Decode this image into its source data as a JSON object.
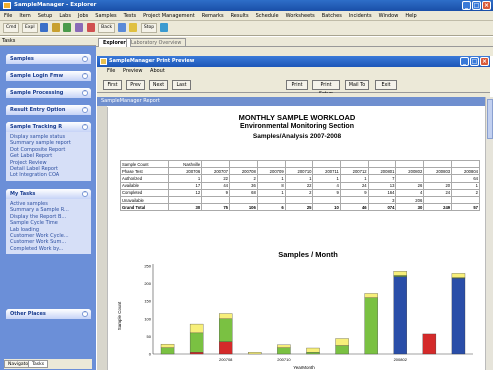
{
  "window": {
    "title": "SampleManager - Explorer"
  },
  "menubar": [
    "File",
    "Item",
    "Setup",
    "Labs",
    "Jobs",
    "Samples",
    "Tests",
    "Project Management",
    "Remarks",
    "Results",
    "Schedule",
    "Worksheets",
    "Batches",
    "Incidents",
    "Window",
    "Help"
  ],
  "toolbar": {
    "items": [
      "Cmd",
      "Expl",
      "Back",
      "Stop"
    ]
  },
  "nav": {
    "header": "Tasks",
    "panels": [
      {
        "title": "Samples",
        "items": []
      },
      {
        "title": "Sample Login Fmw",
        "items": []
      },
      {
        "title": "Sample Processing",
        "items": []
      },
      {
        "title": "Result Entry Option",
        "items": []
      },
      {
        "title": "Sample Tracking R",
        "items": [
          "Display sample status",
          "Summary sample report",
          "Dot Composite Report",
          "Get Label Report",
          "Project Review",
          "Detail Label Report",
          "Lot Integration COA"
        ]
      },
      {
        "title": "My Tasks",
        "items": [
          "Active samples",
          "Summary a Sample R...",
          "Display the Report B...",
          "Sample Cycle Time",
          "Lab loading",
          "Customer Work Cycle...",
          "Customer Work Sum...",
          "Completed Work by..."
        ]
      },
      {
        "title": "Other Places",
        "items": []
      }
    ],
    "tabs": [
      "Navigator",
      "Tasks"
    ]
  },
  "tabs": [
    {
      "label": "Explorer"
    },
    {
      "label": "Laboratory Overview"
    }
  ],
  "preview": {
    "title": "SampleManager Print Preview",
    "menu": [
      "File",
      "Preview",
      "About"
    ],
    "buttons": [
      "First",
      "Prev",
      "Next",
      "Last",
      "Print",
      "Print Setup",
      "Mail To",
      "Exit"
    ],
    "report_strip": "SampleManager Report"
  },
  "report": {
    "title1": "MONTHLY SAMPLE WORKLOAD",
    "title2": "Environmental Monitoring Section",
    "title3": "Samples/Analysis 2007-2008",
    "table": {
      "corner_label": "Sample Count",
      "facility": "Nashville",
      "phase_label": "Phase Test",
      "columns": [
        "200706",
        "200707",
        "200708",
        "200709",
        "200710",
        "200711",
        "200712",
        "200801",
        "200802",
        "200803",
        "200804"
      ],
      "rows": [
        {
          "label": "Authorized",
          "values": [
            "1",
            "22",
            "2",
            "1",
            "1",
            "1",
            "1",
            "7",
            "",
            "",
            "64"
          ]
        },
        {
          "label": "Available",
          "values": [
            "17",
            "44",
            "36",
            "8",
            "22",
            "4",
            "24",
            "13",
            "26",
            "20",
            "1"
          ]
        },
        {
          "label": "Completed",
          "values": [
            "12",
            "9",
            "68",
            "1",
            "2",
            "9",
            "9",
            "164",
            "4",
            "24",
            "2"
          ]
        },
        {
          "label": "Unavailable",
          "values": [
            "",
            "",
            "",
            "",
            "",
            "",
            "",
            "3",
            "206",
            "",
            ""
          ]
        }
      ],
      "total": {
        "label": "Grand Total",
        "values": [
          "30",
          "75",
          "106",
          "6",
          "25",
          "10",
          "46",
          "074",
          "30",
          "249",
          "57"
        ]
      }
    }
  },
  "chart_data": {
    "type": "bar",
    "title": "Samples / Month",
    "xlabel": "YearMonth",
    "ylabel": "Sample Count",
    "ylim": [
      0,
      250
    ],
    "yticks": [
      0,
      50,
      100,
      150,
      200,
      250
    ],
    "xtick_labels": [
      "200708",
      "200710",
      "200802"
    ],
    "categories": [
      "200706",
      "200707",
      "200708",
      "200709",
      "200710",
      "200711",
      "200712",
      "200801",
      "200802",
      "200803",
      "200804"
    ],
    "series": [
      {
        "color": "#2a4ea8",
        "values": [
          0,
          0,
          0,
          0,
          0,
          0,
          0,
          0,
          220,
          0,
          215
        ]
      },
      {
        "color": "#d42a2a",
        "values": [
          0,
          5,
          35,
          0,
          0,
          0,
          0,
          0,
          0,
          57,
          0
        ]
      },
      {
        "color": "#7ac142",
        "values": [
          18,
          55,
          65,
          0,
          18,
          5,
          24,
          160,
          3,
          0,
          2
        ]
      },
      {
        "color": "#f7ef7a",
        "values": [
          10,
          25,
          15,
          5,
          8,
          12,
          20,
          12,
          12,
          0,
          12
        ]
      }
    ]
  },
  "colors": {
    "title_blue": "#1a4fa8",
    "nav_blue": "#6b8fd8"
  }
}
